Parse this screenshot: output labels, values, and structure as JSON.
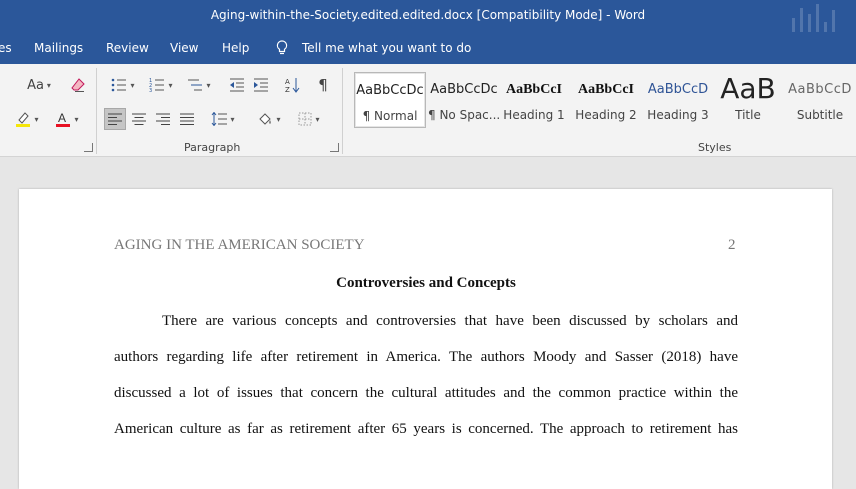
{
  "window": {
    "title": "Aging-within-the-Society.edited.edited.docx [Compatibility Mode]  -  Word"
  },
  "tabs": [
    {
      "label": "es"
    },
    {
      "label": "Mailings"
    },
    {
      "label": "Review"
    },
    {
      "label": "View"
    },
    {
      "label": "Help"
    }
  ],
  "tellme": {
    "label": "Tell me what you want to do",
    "icon": "lightbulb-icon"
  },
  "ribbon": {
    "font_group": {
      "case_label": "Aa",
      "highlight_color": "#f5e60a",
      "font_color": "#e81123"
    },
    "paragraph_group": {
      "label": "Paragraph"
    },
    "styles_group": {
      "label": "Styles",
      "items": [
        {
          "preview": "AaBbCcDc",
          "name": "¶ Normal"
        },
        {
          "preview": "AaBbCcDc",
          "name": "¶ No Spac..."
        },
        {
          "preview": "AaBbCcI",
          "name": "Heading 1"
        },
        {
          "preview": "AaBbCcI",
          "name": "Heading 2"
        },
        {
          "preview": "AaBbCcD",
          "name": "Heading 3"
        },
        {
          "preview": "AaB",
          "name": "Title"
        },
        {
          "preview": "AaBbCcD",
          "name": "Subtitle"
        }
      ]
    }
  },
  "document": {
    "running_head": "AGING IN THE AMERICAN SOCIETY",
    "page_number": "2",
    "heading": "Controversies and Concepts",
    "lines": [
      "There are various concepts and controversies that have been discussed by  scholars and",
      "authors regarding life after retirement in America. The authors Moody and Sasser (2018) have",
      "discussed a lot of issues that concern the cultural attitudes and the common practice within the",
      "American culture as far as retirement after 65 years is concerned. The approach to retirement has"
    ]
  }
}
